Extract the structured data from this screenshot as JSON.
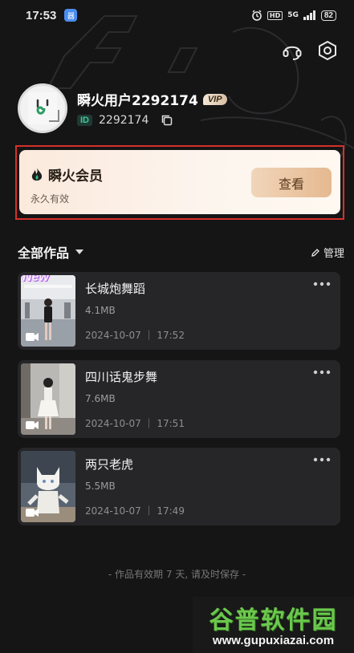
{
  "status_bar": {
    "time": "17:53",
    "app_badge": "器",
    "network": "5G",
    "hd": "HD",
    "battery": "82"
  },
  "header": {
    "support_icon": "headset-icon",
    "settings_icon": "hexagon-settings-icon"
  },
  "profile": {
    "username": "瞬火用户2292174",
    "vip_label": "VIP",
    "id_label": "ID",
    "id_value": "2292174"
  },
  "membership": {
    "title": "瞬火会员",
    "subtitle": "永久有效",
    "button_label": "查看",
    "accent": "#e5b990"
  },
  "works": {
    "header": "全部作品",
    "manage_label": "管理",
    "items": [
      {
        "title": "长城炮舞蹈",
        "size": "4.1MB",
        "date": "2024-10-07 ｜ 17:52",
        "new_tag": "New"
      },
      {
        "title": "四川话鬼步舞",
        "size": "7.6MB",
        "date": "2024-10-07 ｜ 17:51"
      },
      {
        "title": "两只老虎",
        "size": "5.5MB",
        "date": "2024-10-07 ｜ 17:49"
      }
    ]
  },
  "footer_note": "- 作品有效期 7 天, 请及时保存 -",
  "watermark": {
    "title": "谷普软件园",
    "url": "www.gupuxiazai.com"
  }
}
